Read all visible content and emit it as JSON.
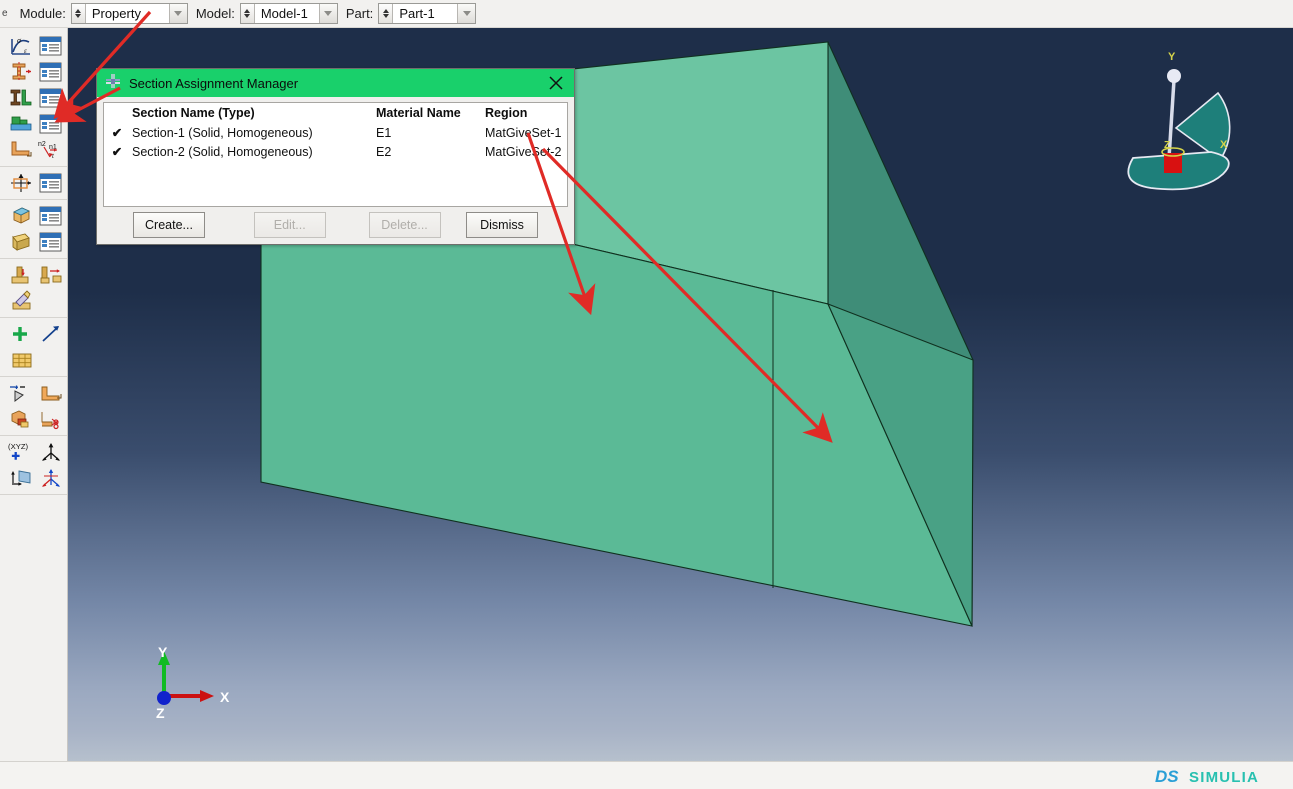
{
  "app": {
    "edge_label": "e",
    "logo_text": "SIMULIA",
    "logo_mark": "DS"
  },
  "context_bar": {
    "module": {
      "label": "Module:",
      "value": "Property"
    },
    "model": {
      "label": "Model:",
      "value": "Model-1"
    },
    "part": {
      "label": "Part:",
      "value": "Part-1"
    }
  },
  "toolbar": {
    "groups": [
      {
        "name": "material-group",
        "rows": [
          {
            "buttons": [
              "create-material-icon",
              "material-manager-icon"
            ]
          },
          {
            "buttons": [
              "create-section-icon",
              "section-manager-icon"
            ]
          },
          {
            "buttons": [
              "assign-section-icon",
              "section-assignment-manager-icon"
            ]
          },
          {
            "buttons": [
              "create-profile-icon",
              "profile-manager-icon"
            ]
          },
          {
            "buttons": [
              "assign-beam-orientation-icon",
              "assign-normal-tangent-icon"
            ]
          }
        ]
      },
      {
        "name": "composite-group",
        "rows": [
          {
            "buttons": [
              "create-composite-layup-icon",
              "composite-layup-manager-icon"
            ]
          }
        ]
      },
      {
        "name": "skin-group",
        "rows": [
          {
            "buttons": [
              "create-skin-icon",
              "skin-manager-icon"
            ]
          },
          {
            "buttons": [
              "create-stringer-icon",
              "stringer-manager-icon"
            ]
          }
        ]
      },
      {
        "name": "inertia-group",
        "rows": [
          {
            "buttons": [
              "create-inertia-icon",
              "assign-inertia-icon"
            ]
          },
          {
            "buttons": [
              "edit-inertia-icon"
            ]
          }
        ]
      },
      {
        "name": "special-group",
        "rows": [
          {
            "buttons": [
              "create-point-icon",
              "create-datum-axis-icon"
            ]
          },
          {
            "buttons": [
              "create-partition-icon"
            ]
          }
        ]
      },
      {
        "name": "query-group",
        "rows": [
          {
            "buttons": [
              "query-information-icon",
              "assign-midsurface-icon"
            ]
          },
          {
            "buttons": [
              "assign-element-type-icon",
              "repair-geometry-icon"
            ]
          }
        ]
      },
      {
        "name": "datum-group",
        "rows": [
          {
            "buttons": [
              "create-datum-point-xyz-icon",
              "create-datum-csys-icon"
            ]
          },
          {
            "buttons": [
              "create-datum-plane-icon",
              "create-datum-csys-3point-icon"
            ]
          }
        ]
      }
    ]
  },
  "dialog": {
    "title": "Section Assignment Manager",
    "title_icon": "abaqus-dialog-icon",
    "close_icon": "close-icon",
    "columns": [
      "Section Name (Type)",
      "Material Name",
      "Region"
    ],
    "rows": [
      {
        "checked": "✔",
        "section_name": "Section-1 (Solid, Homogeneous)",
        "material_name": "E1",
        "region": "MatGiveSet-1"
      },
      {
        "checked": "✔",
        "section_name": "Section-2 (Solid, Homogeneous)",
        "material_name": "E2",
        "region": "MatGiveSet-2"
      }
    ],
    "buttons": {
      "create": {
        "label": "Create...",
        "enabled": true
      },
      "edit": {
        "label": "Edit...",
        "enabled": false
      },
      "delete": {
        "label": "Delete...",
        "enabled": false
      },
      "dismiss": {
        "label": "Dismiss",
        "enabled": true
      }
    }
  },
  "viewport": {
    "triad": {
      "x_label": "X",
      "y_label": "Y",
      "z_label": "Z",
      "x_color": "#cc1111",
      "y_color": "#11bb22",
      "z_color": "#1122cc"
    },
    "view_widget": {
      "x_label": "X",
      "y_label": "Y",
      "z_label": "Z",
      "body_color": "#1e7f7a",
      "marker_color": "#d81111"
    },
    "model": {
      "face_front_color": "#5bba96",
      "face_top_color": "#6cc5a2",
      "face_right_color": "#3f8d78",
      "edge_color": "#10301f"
    },
    "background": {
      "top_color": "#1e2e49",
      "bottom_color": "#b6c0cd"
    }
  },
  "annotations": {
    "arrow_color": "#e02b26",
    "arrows": [
      {
        "name": "arrow-to-section-assignment-toolbar-a",
        "from": [
          148,
          13
        ],
        "to": [
          58,
          110
        ]
      },
      {
        "name": "arrow-to-section-assignment-toolbar-b",
        "from": [
          118,
          88
        ],
        "to": [
          62,
          118
        ]
      },
      {
        "name": "arrow-to-region-1",
        "from": [
          530,
          135
        ],
        "to": [
          588,
          308
        ]
      },
      {
        "name": "arrow-to-region-2",
        "from": [
          545,
          150
        ],
        "to": [
          827,
          437
        ]
      }
    ]
  }
}
